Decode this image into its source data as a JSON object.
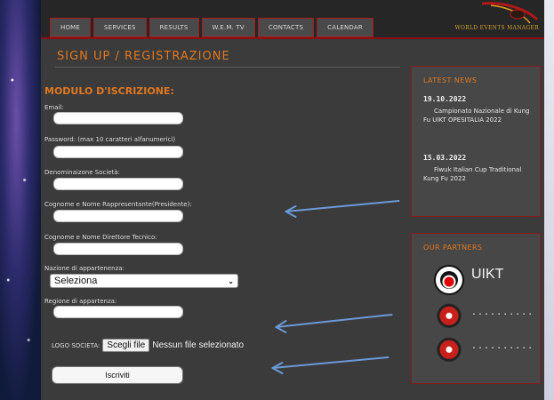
{
  "nav": {
    "items": [
      {
        "label": "HOME"
      },
      {
        "label": "SERVICES"
      },
      {
        "label": "RESULTS"
      },
      {
        "label": "W.E.M. TV"
      },
      {
        "label": "CONTACTS"
      },
      {
        "label": "CALENDAR"
      }
    ]
  },
  "logo": {
    "text": "WORLD EVENTS MANAGER"
  },
  "page": {
    "title": "SIGN UP / REGISTRAZIONE"
  },
  "form": {
    "title": "MODULO D'ISCRIZIONE:",
    "fields": [
      {
        "label": "Email:",
        "value": ""
      },
      {
        "label": "Password: (max 10 caratteri alfanumerici)",
        "value": ""
      },
      {
        "label": "Denominaizone Società:",
        "value": ""
      },
      {
        "label": "Cognome e Nome Rappresentante(Presidente):",
        "value": ""
      },
      {
        "label": "Cognome e Nome Direttore Tecnico:",
        "value": ""
      }
    ],
    "nation": {
      "label": "Nazione di appartenenza:",
      "selected": "Seleziona"
    },
    "region": {
      "label": "Regione di appartenza:",
      "value": ""
    },
    "logo_upload": {
      "label": "LOGO SOCIETA:",
      "button": "Scegli file",
      "status": "Nessun file selezionato"
    },
    "submit_label": "Iscriviti"
  },
  "sidebar": {
    "news": {
      "title": "LATEST NEWS",
      "items": [
        {
          "date": "19.10.2022",
          "text": "Campionato Nazionale di Kung Fu UIKT OPESITALIA 2022"
        },
        {
          "date": "15.03.2022",
          "text": "Fiwuk Italian Cup Traditional Kung Fu 2022"
        }
      ]
    },
    "partners": {
      "title": "OUR PARTNERS",
      "items": [
        {
          "label": "UIKT"
        },
        {
          "label": ".........."
        },
        {
          "label": ".........."
        }
      ]
    }
  },
  "colors": {
    "accent": "#e07820",
    "border_red": "#a81a1a",
    "page_bg": "#3b3b3b",
    "arrow": "#6a9ad8"
  }
}
